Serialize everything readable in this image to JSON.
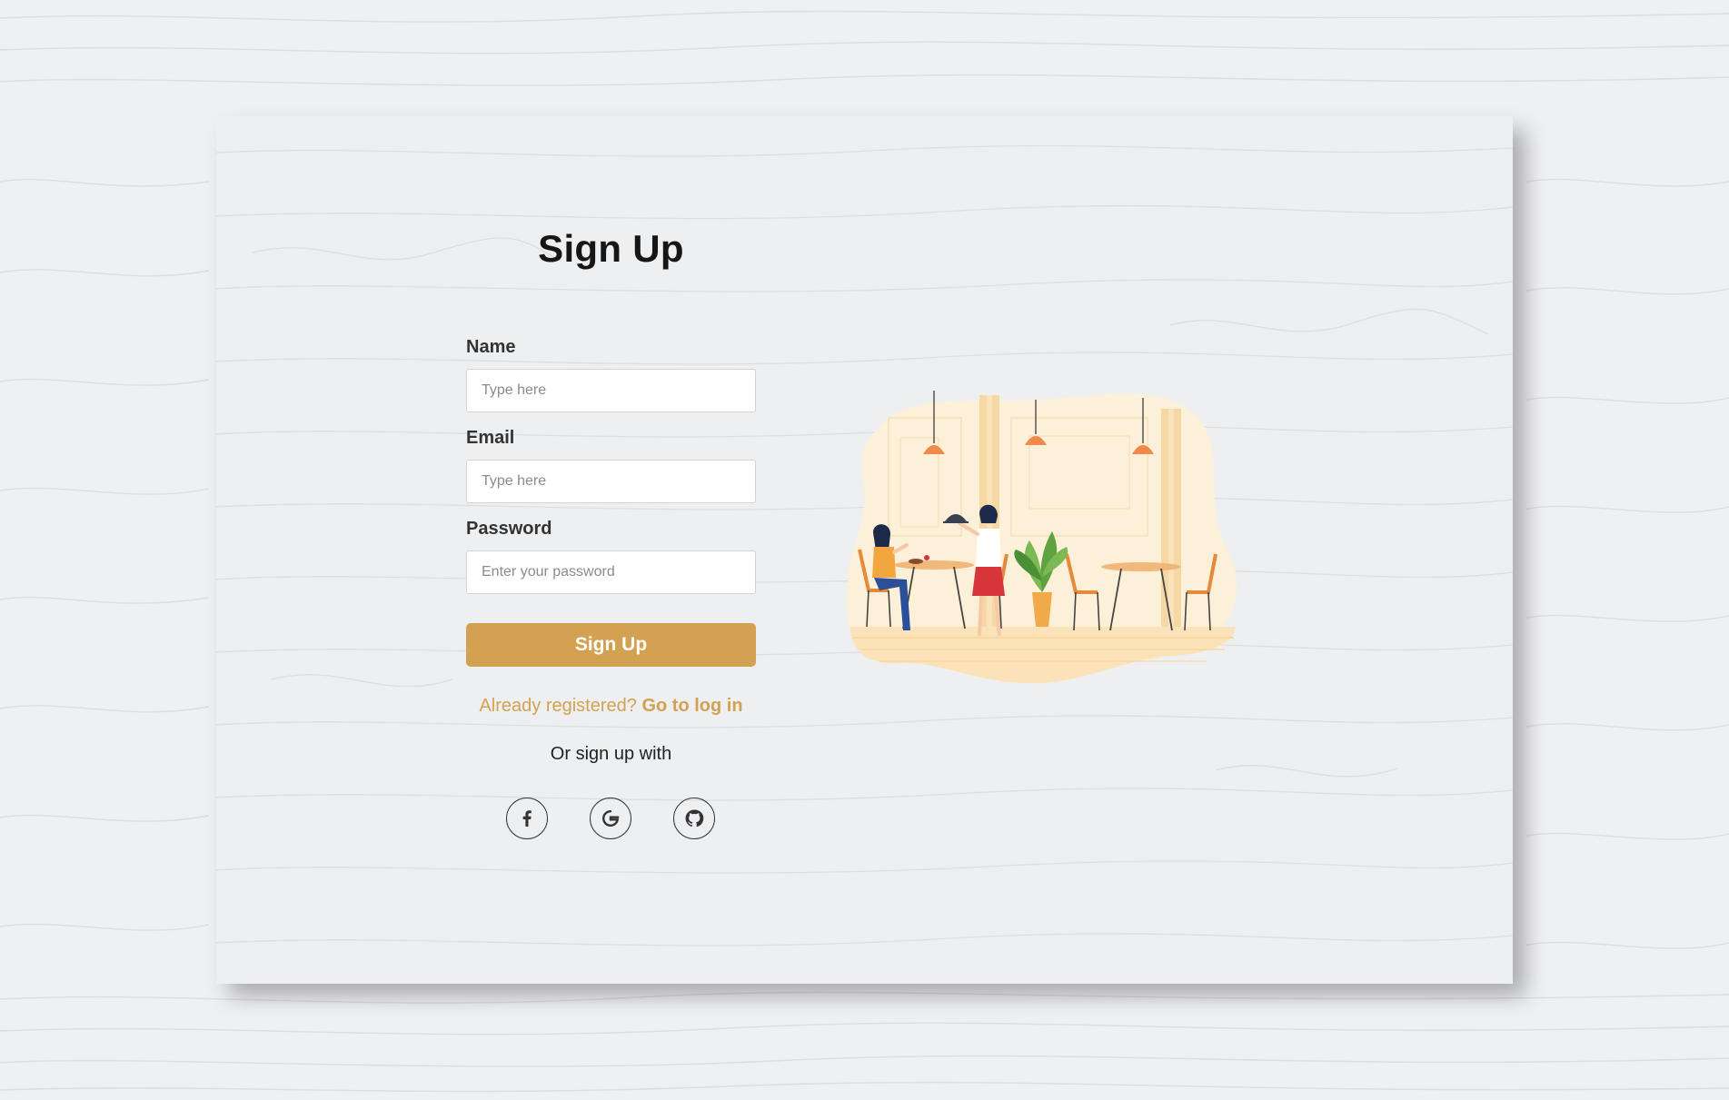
{
  "form": {
    "title": "Sign Up",
    "name_label": "Name",
    "name_placeholder": "Type here",
    "email_label": "Email",
    "email_placeholder": "Type here",
    "password_label": "Password",
    "password_placeholder": "Enter your password",
    "submit_label": "Sign Up",
    "already_registered": "Already registered?",
    "login_link": "Go to log in",
    "or_signup": "Or sign up with"
  },
  "social": [
    {
      "name": "facebook",
      "icon": "facebook-icon"
    },
    {
      "name": "google",
      "icon": "google-icon"
    },
    {
      "name": "github",
      "icon": "github-icon"
    }
  ],
  "colors": {
    "accent": "#d3a152",
    "background": "#eff0f2",
    "title": "#161616"
  }
}
